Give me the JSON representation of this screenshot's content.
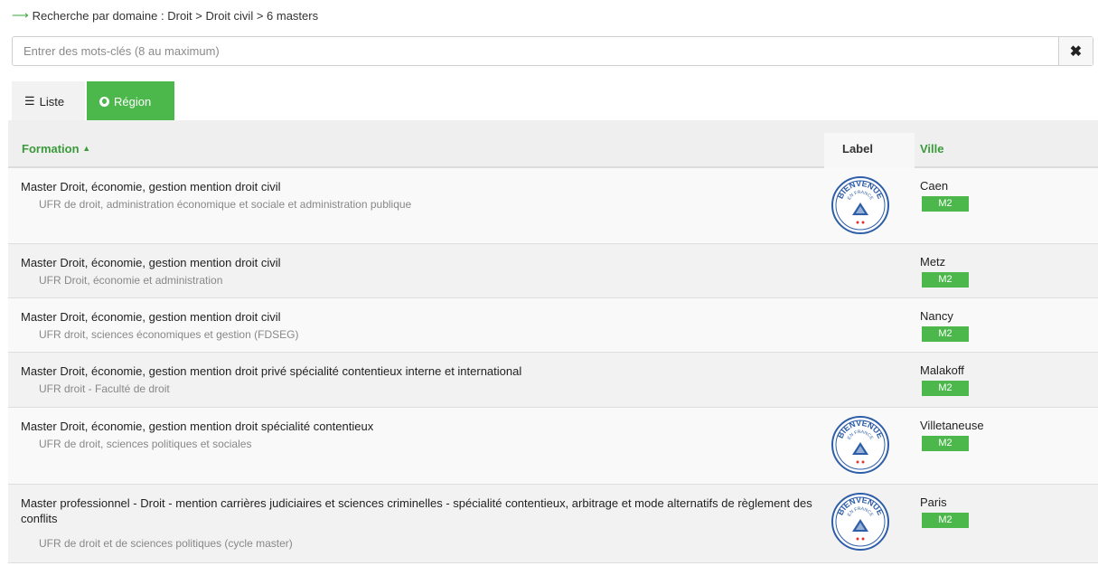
{
  "breadcrumb": {
    "text": "Recherche par domaine : Droit > Droit civil > 6 masters"
  },
  "search": {
    "placeholder": "Entrer des mots-clés (8 au maximum)",
    "value": ""
  },
  "tabs": [
    {
      "label": "Liste",
      "icon": "list-icon",
      "active": false
    },
    {
      "label": "Région",
      "icon": "globe-icon",
      "active": true
    }
  ],
  "table": {
    "headers": {
      "formation": "Formation",
      "label": "Label",
      "ville": "Ville"
    },
    "rows": [
      {
        "title": "Master Droit, économie, gestion mention droit civil",
        "etablissement": "UFR de droit, administration économique et sociale et administration publique",
        "city": "Caen",
        "level": "M2",
        "label": true
      },
      {
        "title": "Master Droit, économie, gestion mention droit civil",
        "etablissement": "UFR Droit, économie et administration",
        "city": "Metz",
        "level": "M2",
        "label": false
      },
      {
        "title": "Master Droit, économie, gestion mention droit civil",
        "etablissement": "UFR droit, sciences économiques et gestion (FDSEG)",
        "city": "Nancy",
        "level": "M2",
        "label": false
      },
      {
        "title": "Master Droit, économie, gestion mention droit privé spécialité contentieux interne et international",
        "etablissement": "UFR droit - Faculté de droit",
        "city": "Malakoff",
        "level": "M2",
        "label": false
      },
      {
        "title": "Master Droit, économie, gestion mention droit spécialité contentieux",
        "etablissement": "UFR de droit, sciences politiques et sociales",
        "city": "Villetaneuse",
        "level": "M2",
        "label": true
      },
      {
        "title": "Master professionnel - Droit - mention carrières judiciaires et sciences criminelles - spécialité contentieux, arbitrage et mode alternatifs de règlement des conflits",
        "etablissement": "UFR de droit et de sciences politiques (cycle master)",
        "city": "Paris",
        "level": "M2",
        "label": true
      }
    ]
  },
  "logo": {
    "top_text": "BIENVENUE",
    "sub_text": "EN FRANCE",
    "color": "#2f5ea8"
  },
  "colors": {
    "accent": "#4cb84c",
    "link": "#3b9a3b"
  }
}
